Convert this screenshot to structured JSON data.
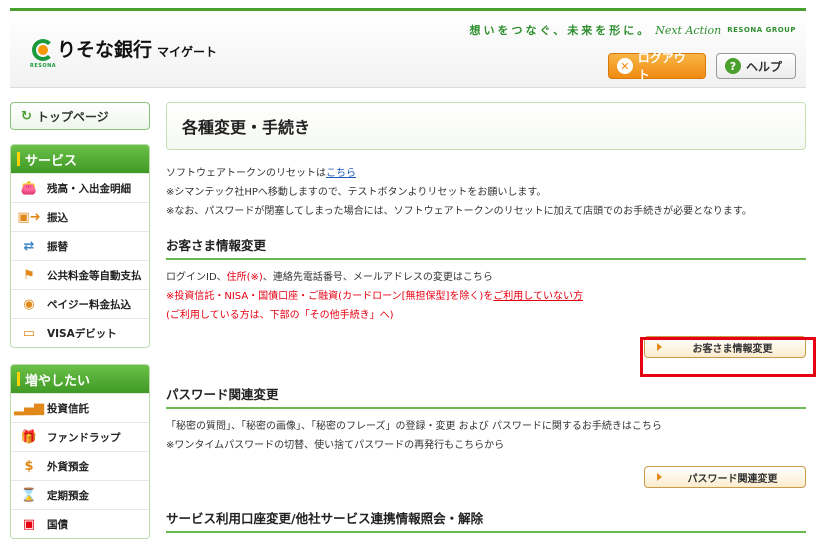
{
  "header": {
    "logo_name": "りそな銀行",
    "logo_sub": "マイゲート",
    "logo_small": "RESONA",
    "tagline": "想いをつなぐ、未来を形に。",
    "tagline_script": "Next Action",
    "tagline_group": "RESONA GROUP",
    "logout_label": "ログアウト",
    "help_label": "ヘルプ"
  },
  "sidebar": {
    "top_label": "トップページ",
    "services": {
      "title": "サービス",
      "items": [
        {
          "label": "残高・入出金明細",
          "icon": "piggy-bank-icon"
        },
        {
          "label": "振込",
          "icon": "transfer-icon"
        },
        {
          "label": "振替",
          "icon": "exchange-icon"
        },
        {
          "label": "公共料金等自動支払",
          "icon": "utility-icon"
        },
        {
          "label": "ペイジー料金払込",
          "icon": "payeasy-icon"
        },
        {
          "label": "VISAデビット",
          "icon": "debit-card-icon"
        }
      ]
    },
    "increase": {
      "title": "増やしたい",
      "items": [
        {
          "label": "投資信託",
          "icon": "chart-icon"
        },
        {
          "label": "ファンドラップ",
          "icon": "gift-icon"
        },
        {
          "label": "外貨預金",
          "icon": "dollar-icon"
        },
        {
          "label": "定期預金",
          "icon": "time-deposit-icon"
        },
        {
          "label": "国債",
          "icon": "bond-icon"
        }
      ]
    }
  },
  "main": {
    "title": "各種変更・手続き",
    "token": {
      "text_before": "ソフトウェアトークンのリセットは",
      "link": "こちら",
      "note1": "※シマンテック社HPへ移動しますので、テストボタンよりリセットをお願いします。",
      "note2": "※なお、パスワードが閉塞してしまった場合には、ソフトウェアトークンのリセットに加えて店頭でのお手続きが必要となります。"
    },
    "customer": {
      "heading": "お客さま情報変更",
      "line1_a": "ログインID、",
      "line1_b": "住所(※)",
      "line1_c": "、連絡先電話番号、メールアドレスの変更はこちら",
      "line2_a": "※投資信託・NISA・国債口座・ご融資(カードローン[無担保型]を除く)を",
      "line2_b": "ご利用していない方",
      "line3": "(ご利用している方は、下部の「その他手続き」へ)",
      "button": "お客さま情報変更"
    },
    "password": {
      "heading": "パスワード関連変更",
      "line1": "「秘密の質問」、「秘密の画像」、「秘密のフレーズ」の登録・変更 および パスワードに関するお手続きはこちら",
      "line2": "※ワンタイムパスワードの切替、使い捨てパスワードの再発行もこちらから",
      "button": "パスワード関連変更"
    },
    "service_heading": "サービス利用口座変更/他社サービス連携情報照会・解除"
  }
}
